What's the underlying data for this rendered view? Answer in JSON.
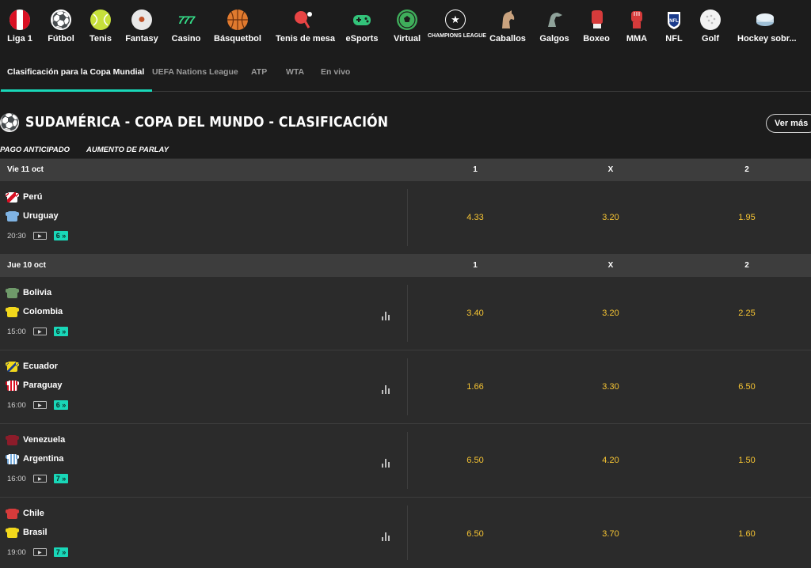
{
  "sports": [
    {
      "label": "Liga 1",
      "icon": "peru-flag-icon"
    },
    {
      "label": "Fútbol",
      "icon": "soccer-ball-icon"
    },
    {
      "label": "Tenis",
      "icon": "tennis-ball-icon"
    },
    {
      "label": "Fantasy",
      "icon": "fantasy-icon"
    },
    {
      "label": "Casino",
      "icon": "slots-777-icon"
    },
    {
      "label": "Básquetbol",
      "icon": "basketball-icon"
    },
    {
      "label": "Tenis de mesa",
      "icon": "table-tennis-icon"
    },
    {
      "label": "eSports",
      "icon": "gamepad-icon"
    },
    {
      "label": "Virtual",
      "icon": "virtual-ball-icon"
    },
    {
      "label": "CHAMPIONS LEAGUE",
      "icon": "champions-league-icon"
    },
    {
      "label": "Caballos",
      "icon": "horse-icon"
    },
    {
      "label": "Galgos",
      "icon": "greyhound-icon"
    },
    {
      "label": "Boxeo",
      "icon": "boxing-glove-icon"
    },
    {
      "label": "MMA",
      "icon": "mma-glove-icon"
    },
    {
      "label": "NFL",
      "icon": "nfl-shield-icon"
    },
    {
      "label": "Golf",
      "icon": "golf-ball-icon"
    },
    {
      "label": "Hockey sobr...",
      "icon": "hockey-puck-icon"
    }
  ],
  "subtabs": [
    {
      "label": "Clasificación para la Copa Mundial",
      "active": true
    },
    {
      "label": "UEFA Nations League",
      "active": false
    },
    {
      "label": "ATP",
      "active": false
    },
    {
      "label": "WTA",
      "active": false
    },
    {
      "label": "En vivo",
      "active": false
    }
  ],
  "competition": {
    "title": "SUDAMÉRICA - COPA DEL MUNDO - CLASIFICACIÓN",
    "ver_mas": "Ver más",
    "promos": [
      "PAGO ANTICIPADO",
      "AUMENTO DE PARLAY"
    ]
  },
  "columns": [
    "1",
    "X",
    "2"
  ],
  "days": [
    {
      "date": "Vie 11 oct",
      "events": [
        {
          "home": "Perú",
          "away": "Uruguay",
          "time": "20:30",
          "markets": "6",
          "odds": [
            "4.33",
            "3.20",
            "1.95"
          ],
          "stats": false
        }
      ]
    },
    {
      "date": "Jue 10 oct",
      "events": [
        {
          "home": "Bolivia",
          "away": "Colombia",
          "time": "15:00",
          "markets": "6",
          "odds": [
            "3.40",
            "3.20",
            "2.25"
          ],
          "stats": true
        },
        {
          "home": "Ecuador",
          "away": "Paraguay",
          "time": "16:00",
          "markets": "6",
          "odds": [
            "1.66",
            "3.30",
            "6.50"
          ],
          "stats": true
        },
        {
          "home": "Venezuela",
          "away": "Argentina",
          "time": "16:00",
          "markets": "7",
          "odds": [
            "6.50",
            "4.20",
            "1.50"
          ],
          "stats": true
        },
        {
          "home": "Chile",
          "away": "Brasil",
          "time": "19:00",
          "markets": "7",
          "odds": [
            "6.50",
            "3.70",
            "1.60"
          ],
          "stats": true
        }
      ]
    }
  ],
  "colors": {
    "accent": "#19d7b8",
    "odds": "#f7c533",
    "background": "#2b2b2b",
    "header": "#1c1c1c",
    "row_header": "#3d3d3d"
  }
}
